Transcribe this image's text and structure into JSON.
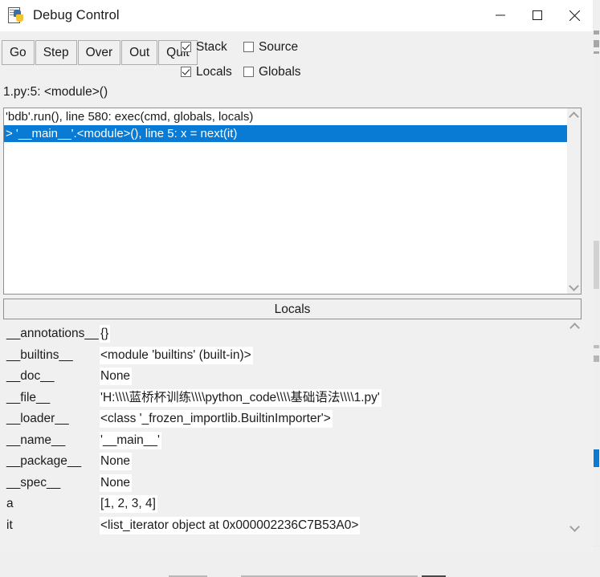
{
  "window": {
    "title": "Debug Control",
    "icon": "python-debug-icon",
    "controls": {
      "minimize": "minimize-icon",
      "maximize": "maximize-icon",
      "close": "close-icon"
    }
  },
  "toolbar": {
    "buttons": [
      {
        "label": "Go"
      },
      {
        "label": "Step"
      },
      {
        "label": "Over"
      },
      {
        "label": "Out"
      },
      {
        "label": "Quit"
      }
    ],
    "checkboxes": [
      {
        "label": "Stack",
        "checked": true
      },
      {
        "label": "Source",
        "checked": false
      },
      {
        "label": "Locals",
        "checked": true
      },
      {
        "label": "Globals",
        "checked": false
      }
    ]
  },
  "status": {
    "line": "1.py:5: <module>()"
  },
  "stack": {
    "rows": [
      {
        "text": "'bdb'.run(), line 580: exec(cmd, globals, locals)",
        "selected": false
      },
      {
        "text": "> '__main__'.<module>(), line 5: x = next(it)",
        "selected": true
      }
    ],
    "scrollbar": {
      "up_arrow": "chevron-up-icon",
      "down_arrow": "chevron-down-icon"
    }
  },
  "locals": {
    "header": "Locals",
    "rows": [
      {
        "key": "__annotations__",
        "value": "{}"
      },
      {
        "key": "__builtins__",
        "value": "<module 'builtins' (built-in)>"
      },
      {
        "key": "__doc__",
        "value": "None"
      },
      {
        "key": "__file__",
        "value": "'H:\\\\\\\\蓝桥杯训练\\\\\\\\python_code\\\\\\\\基础语法\\\\\\\\1.py'"
      },
      {
        "key": "__loader__",
        "value": "<class '_frozen_importlib.BuiltinImporter'>"
      },
      {
        "key": "__name__",
        "value": "'__main__'"
      },
      {
        "key": "__package__",
        "value": "None"
      },
      {
        "key": "__spec__",
        "value": "None"
      },
      {
        "key": "a",
        "value": "[1, 2, 3, 4]"
      },
      {
        "key": "it",
        "value": "<list_iterator object at 0x000002236C7B53A0>"
      }
    ],
    "scrollbar": {
      "up_arrow": "chevron-up-icon",
      "down_arrow": "chevron-down-icon"
    }
  },
  "colors": {
    "selection": "#0a7bd4",
    "window_bg": "#f0f0f0",
    "pane_bg": "#ffffff",
    "border": "#8f8f8f",
    "text": "#1b1b1b"
  }
}
